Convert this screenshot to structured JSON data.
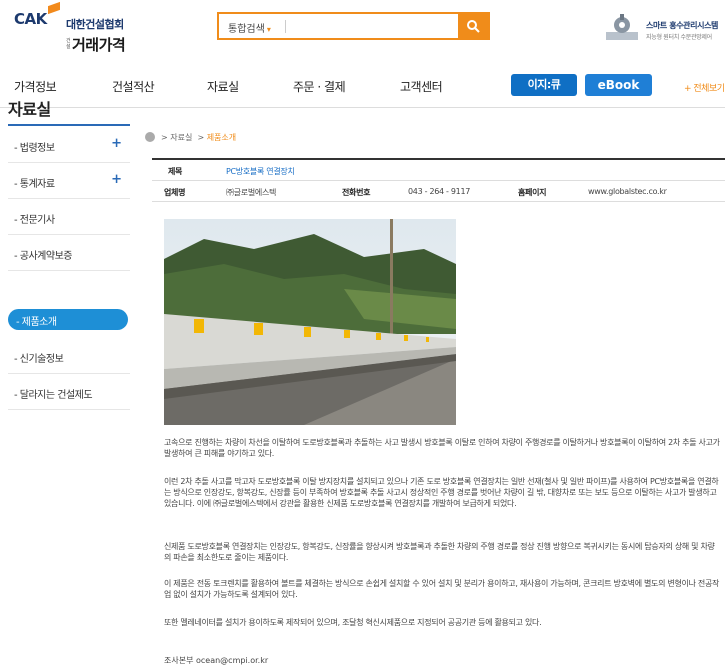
{
  "header": {
    "logo": {
      "brand": "CAK",
      "association": "대한건설협회",
      "service": "거래가격",
      "tag": "건설"
    },
    "search": {
      "scope_label": "통합검색",
      "scope_arrow": "▾",
      "placeholder": "",
      "button_icon": "search-icon"
    },
    "banner": {
      "title": "스마트 홍수관리시스템",
      "subtitle": "지능형 원터치 수문관망제어"
    }
  },
  "gnb": {
    "items": [
      "가격정보",
      "건설적산",
      "자료실",
      "주문 · 결제",
      "고객센터"
    ],
    "ezi_label": "이지:큐",
    "ebook_label": "eBook",
    "all_menu_label": "+ 전체보기"
  },
  "sidebar": {
    "title": "자료실",
    "items": [
      {
        "label": "- 법령정보",
        "plus": "+"
      },
      {
        "label": "- 통계자료",
        "plus": "+"
      },
      {
        "label": "- 전문기사",
        "plus": ""
      },
      {
        "label": "- 공사계약보증",
        "plus": ""
      },
      {
        "label": "- 제품소개",
        "plus": "",
        "active": true
      },
      {
        "label": "- 신기술정보",
        "plus": ""
      },
      {
        "label": "- 달라지는 건설제도",
        "plus": ""
      }
    ]
  },
  "breadcrumb": {
    "sep1": ">",
    "item1": "자료실",
    "sep2": ">",
    "item2": "제품소개"
  },
  "product": {
    "title_label": "제목",
    "title_value": "PC방호블록 연결장치",
    "company_label": "업체명",
    "company_value": "㈜글로벌에스텍",
    "phone_label": "전화번호",
    "phone_value": "043 - 264 - 9117",
    "homepage_label": "홈페이지",
    "homepage_value": "www.globalstec.co.kr"
  },
  "paragraphs": [
    "고속으로 진행하는 차량이 차선을 이탈하여 도로방호블록과 추돌하는 사고 발생시 방호블록 이탈로 인하여 차량이 주행경로를 이탈하거나 방호블록이 이탈하여 2차 추돌 사고가 발생하여 큰 피해를 야기하고 있다.",
    "이런 2차 추돌 사고를 막고자 도로방호블록 이탈 방지장치를 설치되고 있으나 기존 도로 방호블록 연결장치는 일반 선재(철사 및 일반 파이프)를 사용하여 PC방호블록을 연결하는 방식으로 인장강도, 항복강도, 신장률 등이 부족하여 방호블록 추돌 사고시 정상적인 주행 경로를 벗어난 차량이 길 밖, 대향차로 또는 보도 등으로 이탈하는 사고가 발생하고 있습니다. 이에 ㈜글로벌에스텍에서 강관을 활용한 신제품 도로방호블록 연결장치를 개발하여 보급하게 되었다.",
    "신제품 도로방호블록 연결장치는 인장강도, 항복강도, 신장률을 향상시켜 방호블록과 추돌한 차량의 주행 경로를 정상 진행 방향으로 복귀시키는 동시에 탑승자의 상해 및 차량의 파손을 최소한도로 줄이는 제품이다.",
    "이 제품은 전동 토크렌치를 활용하여 볼트를 체결하는 방식으로 손쉽게 설치할 수 있어 설치 및 분리가 용이하고, 재사용이 가능하며, 콘크리트 방호벽에 별도의 변형이나 전공작업 없이 설치가 가능하도록 설계되어 있다.",
    "또한 멜레네이터를 설치가 용이하도록 제작되어 있으며, 조달청 혁신시제품으로 지정되어 공공기관 등에 활용되고 있다."
  ],
  "contact": "조사본부 ocean@cmpi.or.kr",
  "colors": {
    "accent_orange": "#f08c1a",
    "brand_blue": "#1d3a6e",
    "active_blue": "#1e8fd6"
  }
}
